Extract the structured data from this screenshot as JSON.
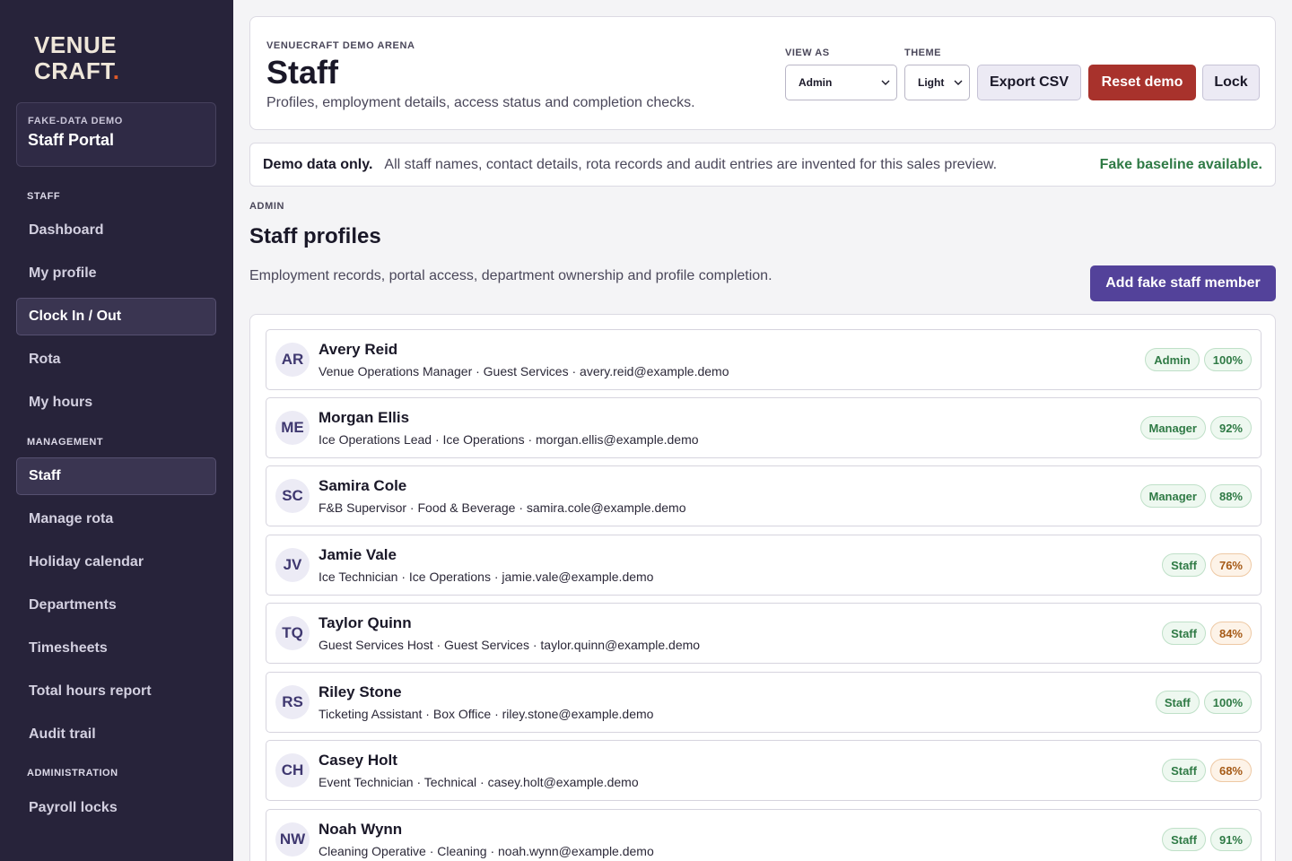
{
  "sidebar": {
    "logo_line1": "VENUE",
    "logo_line2": "CRAFT",
    "logo_dot": ".",
    "portal_kicker": "FAKE-DATA DEMO",
    "portal_name": "Staff Portal",
    "sections": {
      "staff": "STAFF",
      "management": "MANAGEMENT",
      "administration": "ADMINISTRATION"
    },
    "items": [
      {
        "label": "Dashboard"
      },
      {
        "label": "My profile"
      },
      {
        "label": "Clock In / Out"
      },
      {
        "label": "Rota"
      },
      {
        "label": "My hours"
      },
      {
        "label": "Staff"
      },
      {
        "label": "Manage rota"
      },
      {
        "label": "Holiday calendar"
      },
      {
        "label": "Departments"
      },
      {
        "label": "Timesheets"
      },
      {
        "label": "Total hours report"
      },
      {
        "label": "Audit trail"
      },
      {
        "label": "Payroll locks"
      }
    ]
  },
  "header": {
    "kicker": "VENUECRAFT DEMO ARENA",
    "title": "Staff",
    "subtitle": "Profiles, employment details, access status and completion checks.",
    "view_as_label": "VIEW AS",
    "view_as_value": "Admin",
    "theme_label": "THEME",
    "theme_value": "Light",
    "export_label": "Export CSV",
    "reset_label": "Reset demo",
    "lock_label": "Lock"
  },
  "banner": {
    "strong": "Demo data only.",
    "text": "All staff names, contact details, rota records and audit entries are invented for this sales preview.",
    "status": "Fake baseline available."
  },
  "section": {
    "kicker": "ADMIN",
    "title": "Staff profiles",
    "subtitle": "Employment records, portal access, department ownership and profile completion.",
    "add_label": "Add fake staff member"
  },
  "staff": [
    {
      "initials": "AR",
      "name": "Avery Reid",
      "meta": "Venue Operations Manager · Guest Services · avery.reid@example.demo",
      "role": "Admin",
      "completion": "100%",
      "complete_status": "ok"
    },
    {
      "initials": "ME",
      "name": "Morgan Ellis",
      "meta": "Ice Operations Lead · Ice Operations · morgan.ellis@example.demo",
      "role": "Manager",
      "completion": "92%",
      "complete_status": "ok"
    },
    {
      "initials": "SC",
      "name": "Samira Cole",
      "meta": "F&B Supervisor · Food & Beverage · samira.cole@example.demo",
      "role": "Manager",
      "completion": "88%",
      "complete_status": "ok"
    },
    {
      "initials": "JV",
      "name": "Jamie Vale",
      "meta": "Ice Technician · Ice Operations · jamie.vale@example.demo",
      "role": "Staff",
      "completion": "76%",
      "complete_status": "warn"
    },
    {
      "initials": "TQ",
      "name": "Taylor Quinn",
      "meta": "Guest Services Host · Guest Services · taylor.quinn@example.demo",
      "role": "Staff",
      "completion": "84%",
      "complete_status": "warn"
    },
    {
      "initials": "RS",
      "name": "Riley Stone",
      "meta": "Ticketing Assistant · Box Office · riley.stone@example.demo",
      "role": "Staff",
      "completion": "100%",
      "complete_status": "ok"
    },
    {
      "initials": "CH",
      "name": "Casey Holt",
      "meta": "Event Technician · Technical · casey.holt@example.demo",
      "role": "Staff",
      "completion": "68%",
      "complete_status": "warn"
    },
    {
      "initials": "NW",
      "name": "Noah Wynn",
      "meta": "Cleaning Operative · Cleaning · noah.wynn@example.demo",
      "role": "Staff",
      "completion": "91%",
      "complete_status": "ok"
    }
  ],
  "colors": {
    "sidebar_bg": "#27233a",
    "accent": "#53429a",
    "danger": "#a8322c",
    "success": "#2f7a45",
    "warning": "#a55a16"
  }
}
